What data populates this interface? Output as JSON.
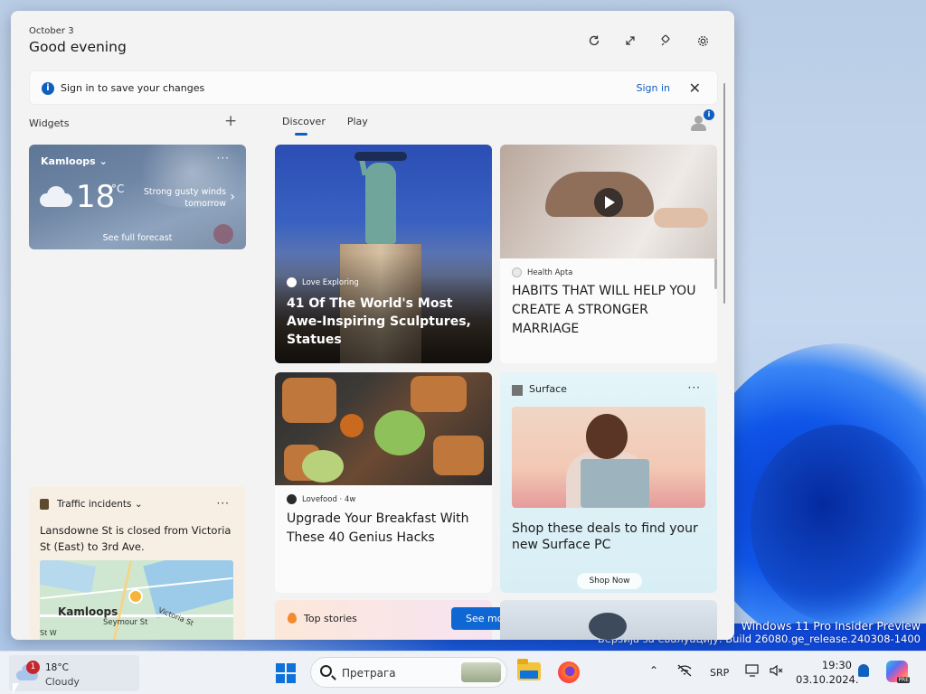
{
  "board": {
    "date": "October 3",
    "greeting": "Good evening"
  },
  "signin_banner": {
    "message": "Sign in to save your changes",
    "link": "Sign in"
  },
  "widgets_panel": {
    "title": "Widgets",
    "add_symbol": "+"
  },
  "tabs": [
    {
      "label": "Discover",
      "active": true
    },
    {
      "label": "Play",
      "active": false
    }
  ],
  "profile_badge": "i",
  "weather": {
    "city": "Kamloops",
    "more": "···",
    "temperature": "18",
    "unit": "°C",
    "condition": "Strong gusty winds tomorrow",
    "forecast_link": "See full forecast"
  },
  "traffic": {
    "title": "Traffic incidents",
    "more": "···",
    "description": "Lansdowne St is closed from Victoria St (East) to 3rd Ave.",
    "map_city": "Kamloops",
    "map_street1": "Seymour St",
    "map_street2": "Victoria St",
    "map_street3": "St W"
  },
  "cards": {
    "liberty": {
      "source": "Love Exploring",
      "headline": "41 Of The World's Most Awe-Inspiring Sculptures, Statues"
    },
    "health": {
      "source": "Health Apta",
      "headline": "HABITS THAT WILL HELP YOU CREATE A STRONGER MARRIAGE"
    },
    "food": {
      "source": "Lovefood · 4w",
      "headline": "Upgrade Your Breakfast With These 40 Genius Hacks"
    },
    "surface": {
      "brand": "Surface",
      "more": "···",
      "headline": "Shop these deals to find your new Surface PC",
      "cta": "Shop Now"
    },
    "top_stories": {
      "label": "Top stories",
      "see_more": "See more"
    }
  },
  "watermark": {
    "line1": "Windows 11 Pro Insider Preview",
    "line2": "Верзија за евалуацију. Build 26080.ge_release.240308-1400"
  },
  "taskbar": {
    "weather_temp": "18°C",
    "weather_cond": "Cloudy",
    "weather_badge": "1",
    "search_placeholder": "Претрага",
    "language": "SRP",
    "time": "19:30",
    "date": "03.10.2024.",
    "copilot_tag": "PRE"
  },
  "colors": {
    "accent": "#0f5fbf",
    "see_more_button": "#0f67d4"
  }
}
